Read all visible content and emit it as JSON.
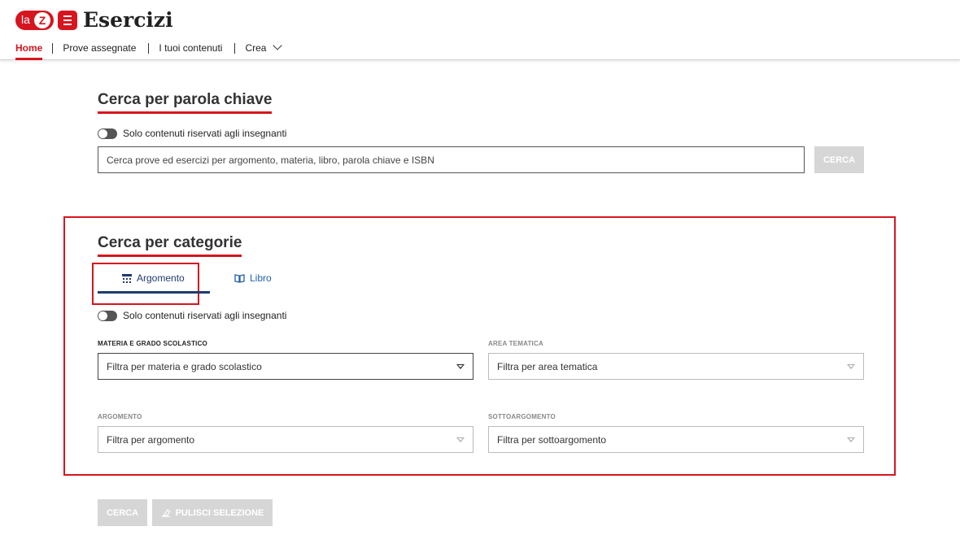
{
  "app": {
    "logo_la": "la",
    "logo_z": "Z",
    "title": "Esercizi"
  },
  "nav": {
    "items": [
      {
        "label": "Home",
        "active": true
      },
      {
        "label": "Prove assegnate",
        "active": false
      },
      {
        "label": "I tuoi contenuti",
        "active": false
      },
      {
        "label": "Crea",
        "active": false
      }
    ]
  },
  "keyword_search": {
    "title": "Cerca per parola chiave",
    "toggle_label": "Solo contenuti riservati agli insegnanti",
    "toggle_on": false,
    "placeholder": "Cerca prove ed esercizi per argomento, materia, libro, parola chiave e ISBN",
    "button_label": "CERCA"
  },
  "category_search": {
    "title": "Cerca per categorie",
    "tabs": [
      {
        "label": "Argomento",
        "icon": "hierarchy-icon",
        "active": true
      },
      {
        "label": "Libro",
        "icon": "book-icon",
        "active": false
      }
    ],
    "toggle_label": "Solo contenuti riservati agli insegnanti",
    "toggle_on": false,
    "fields": {
      "materia": {
        "label": "MATERIA E GRADO SCOLASTICO",
        "placeholder": "Filtra per materia e grado scolastico"
      },
      "area": {
        "label": "AREA TEMATICA",
        "placeholder": "Filtra per area tematica"
      },
      "argomento": {
        "label": "ARGOMENTO",
        "placeholder": "Filtra per argomento"
      },
      "sottoargomento": {
        "label": "SOTTOARGOMENTO",
        "placeholder": "Filtra per sottoargomento"
      }
    }
  },
  "actions": {
    "search_label": "CERCA",
    "clear_label": "PULISCI SELEZIONE"
  },
  "colors": {
    "brand_red": "#d6151f",
    "tab_navy": "#1e3a6e",
    "disabled_button": "#d6d6d6"
  }
}
